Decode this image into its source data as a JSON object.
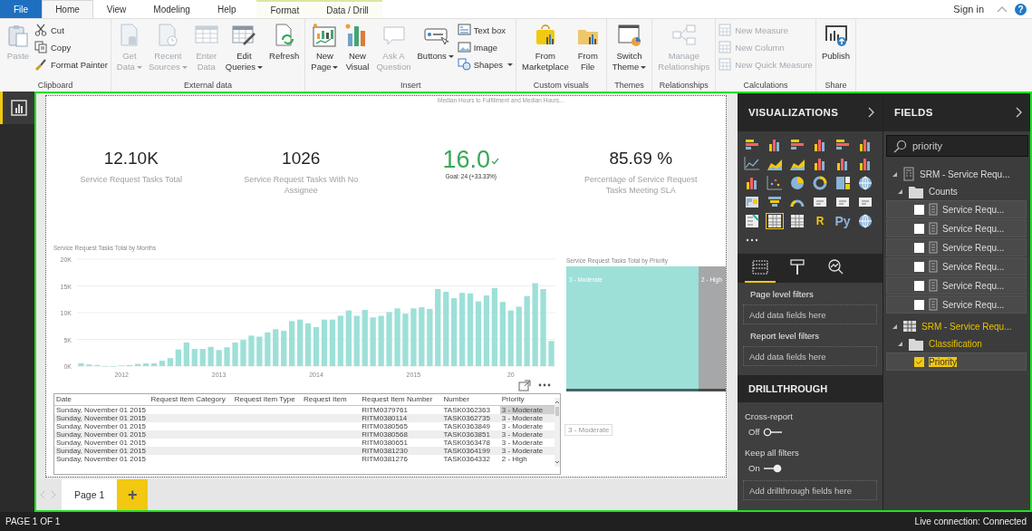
{
  "ribbon": {
    "tabs": [
      {
        "label": "File",
        "kind": "file",
        "selected": false
      },
      {
        "label": "Home",
        "kind": "plain",
        "selected": true
      },
      {
        "label": "View",
        "kind": "plain",
        "selected": false
      },
      {
        "label": "Modeling",
        "kind": "plain",
        "selected": false
      },
      {
        "label": "Help",
        "kind": "plain",
        "selected": false
      },
      {
        "label": "Format",
        "kind": "contextual",
        "selected": false
      },
      {
        "label": "Data / Drill",
        "kind": "contextual",
        "selected": false
      }
    ],
    "sign_in": "Sign in",
    "help": "?",
    "groups": [
      {
        "label": "Clipboard",
        "items": [
          {
            "kind": "large",
            "label": "Paste",
            "disabled": true,
            "dropdown": false
          },
          {
            "kind": "small",
            "label": "Cut",
            "disabled": false,
            "dropdown": false
          },
          {
            "kind": "small",
            "label": "Copy",
            "disabled": false,
            "dropdown": false
          },
          {
            "kind": "small",
            "label": "Format Painter",
            "disabled": false,
            "dropdown": false
          }
        ]
      },
      {
        "label": "External data",
        "items": [
          {
            "kind": "large",
            "label": "Get\nData",
            "disabled": true,
            "dropdown": true
          },
          {
            "kind": "large",
            "label": "Recent\nSources",
            "disabled": true,
            "dropdown": true
          },
          {
            "kind": "large",
            "label": "Enter\nData",
            "disabled": true,
            "dropdown": false
          },
          {
            "kind": "large",
            "label": "Edit\nQueries",
            "disabled": false,
            "dropdown": true
          },
          {
            "kind": "large",
            "label": "Refresh",
            "disabled": false,
            "dropdown": false
          }
        ]
      },
      {
        "label": "Insert",
        "items": [
          {
            "kind": "large",
            "label": "New\nPage",
            "disabled": false,
            "dropdown": true
          },
          {
            "kind": "large",
            "label": "New\nVisual",
            "disabled": false,
            "dropdown": false
          },
          {
            "kind": "large",
            "label": "Ask A\nQuestion",
            "disabled": true,
            "dropdown": false
          },
          {
            "kind": "large",
            "label": "Buttons",
            "disabled": false,
            "dropdown": true
          },
          {
            "kind": "small",
            "label": "Text box",
            "disabled": false,
            "dropdown": false
          },
          {
            "kind": "small",
            "label": "Image",
            "disabled": false,
            "dropdown": false
          },
          {
            "kind": "small",
            "label": "Shapes",
            "disabled": false,
            "dropdown": true
          }
        ]
      },
      {
        "label": "Custom visuals",
        "items": [
          {
            "kind": "large",
            "label": "From\nMarketplace",
            "disabled": false,
            "dropdown": false
          },
          {
            "kind": "large",
            "label": "From\nFile",
            "disabled": false,
            "dropdown": false
          }
        ]
      },
      {
        "label": "Themes",
        "items": [
          {
            "kind": "large",
            "label": "Switch\nTheme",
            "disabled": false,
            "dropdown": true
          }
        ]
      },
      {
        "label": "Relationships",
        "items": [
          {
            "kind": "large",
            "label": "Manage\nRelationships",
            "disabled": true,
            "dropdown": false
          }
        ]
      },
      {
        "label": "Calculations",
        "items": [
          {
            "kind": "small",
            "label": "New Measure",
            "disabled": true,
            "dropdown": false
          },
          {
            "kind": "small",
            "label": "New Column",
            "disabled": true,
            "dropdown": false
          },
          {
            "kind": "small",
            "label": "New Quick Measure",
            "disabled": true,
            "dropdown": false
          }
        ]
      },
      {
        "label": "Share",
        "items": [
          {
            "kind": "large",
            "label": "Publish",
            "disabled": false,
            "dropdown": false
          }
        ]
      }
    ]
  },
  "report": {
    "header_title": "Median Hours to Fulfillment and Median Hours...",
    "cards": [
      {
        "kind": "card",
        "value": "12.10K",
        "label": "Service Request Tasks Total"
      },
      {
        "kind": "card",
        "value": "1026",
        "label": "Service Request Tasks With No Assignee"
      },
      {
        "kind": "kpi",
        "value": "16.0",
        "goal": "Goal: 24 (+33.33%)"
      },
      {
        "kind": "card",
        "value": "85.69 %",
        "label": "Percentage of Service Request Tasks Meeting SLA"
      }
    ],
    "bar_chart": {
      "chart_data": {
        "type": "bar",
        "title": "Service Request Tasks Total by Months",
        "grid": true,
        "color": "#9de0d8",
        "categories": [
          null,
          null,
          null,
          null,
          null,
          "2012",
          null,
          null,
          null,
          null,
          null,
          null,
          null,
          null,
          null,
          null,
          null,
          "2013",
          null,
          null,
          null,
          null,
          null,
          null,
          null,
          null,
          null,
          null,
          null,
          "2014",
          null,
          null,
          null,
          null,
          null,
          null,
          null,
          null,
          null,
          null,
          null,
          "2015",
          null,
          null,
          null,
          null,
          null,
          null,
          null,
          null,
          null,
          null,
          null,
          "20",
          null,
          null,
          null,
          null,
          null
        ],
        "values": [
          0.5,
          0.3,
          0.2,
          0,
          0,
          0.1,
          0.2,
          0.4,
          0.5,
          0.5,
          1,
          1.5,
          3.1,
          4.4,
          3.2,
          3.2,
          3.6,
          3,
          3.5,
          4.4,
          4.9,
          5.7,
          5.5,
          6.3,
          6.9,
          6.6,
          8.4,
          8.7,
          8,
          7.3,
          8.7,
          8.7,
          9.4,
          10.4,
          9.4,
          10.5,
          9.1,
          9.4,
          10.1,
          10.8,
          9.8,
          10.8,
          11,
          10.7,
          14.4,
          13.9,
          12.7,
          13.7,
          13.6,
          12.1,
          13.2,
          14.6,
          12,
          10.4,
          11.1,
          13.1,
          15.5,
          14.4,
          4.7
        ],
        "ylim": [
          0,
          20
        ],
        "yticks": [
          {
            "value": 0,
            "label": "0K"
          },
          {
            "value": 5,
            "label": "5K"
          },
          {
            "value": 10,
            "label": "10K"
          },
          {
            "value": 15,
            "label": "15K"
          },
          {
            "value": 20,
            "label": "20K"
          }
        ]
      }
    },
    "treemap": {
      "title": "Service Request Tasks Total by Priority",
      "tiles": [
        {
          "label": "3 - Moderate",
          "color": "#9de0d8"
        },
        {
          "label": "2 - High",
          "color": "#a5a7a9"
        }
      ]
    },
    "table": {
      "columns": [
        "Date",
        "Request Item Category",
        "Request Item Type",
        "Request Item",
        "Request Item Number",
        "Number",
        "Priority"
      ],
      "rows": [
        {
          "hovered": true,
          "cells": [
            "Sunday, November 01 2015",
            null,
            null,
            null,
            "RITM0379761",
            "TASK0362363",
            "3 - Moderate"
          ]
        },
        {
          "hovered": false,
          "cells": [
            "Sunday, November 01 2015",
            null,
            null,
            null,
            "RITM0380114",
            "TASK0362735",
            "3 - Moderate"
          ]
        },
        {
          "hovered": false,
          "cells": [
            "Sunday, November 01 2015",
            null,
            null,
            null,
            "RITM0380565",
            "TASK0363849",
            "3 - Moderate"
          ]
        },
        {
          "hovered": false,
          "cells": [
            "Sunday, November 01 2015",
            null,
            null,
            null,
            "RITM0380568",
            "TASK0363851",
            "3 - Moderate"
          ]
        },
        {
          "hovered": false,
          "cells": [
            "Sunday, November 01 2015",
            null,
            null,
            null,
            "RITM0380651",
            "TASK0363478",
            "3 - Moderate"
          ]
        },
        {
          "hovered": false,
          "cells": [
            "Sunday, November 01 2015",
            null,
            null,
            null,
            "RITM0381230",
            "TASK0364199",
            "3 - Moderate"
          ]
        },
        {
          "hovered": false,
          "cells": [
            "Sunday, November 01 2015",
            null,
            null,
            null,
            "RITM0381276",
            "TASK0364332",
            "2 - High"
          ]
        }
      ],
      "tooltip": "3 - Moderate"
    },
    "pages": [
      {
        "label": "Page 1",
        "selected": true
      }
    ],
    "add_page": "+"
  },
  "visualizations": {
    "title": "VISUALIZATIONS",
    "gallery": [
      {
        "selected": false
      },
      {
        "selected": false
      },
      {
        "selected": false
      },
      {
        "selected": false
      },
      {
        "selected": false
      },
      {
        "selected": false
      },
      {
        "selected": false
      },
      {
        "selected": false
      },
      {
        "selected": false
      },
      {
        "selected": false
      },
      {
        "selected": false
      },
      {
        "selected": false
      },
      {
        "selected": false
      },
      {
        "selected": false
      },
      {
        "selected": false
      },
      {
        "selected": false
      },
      {
        "selected": false
      },
      {
        "selected": false
      },
      {
        "selected": false
      },
      {
        "selected": false
      },
      {
        "selected": false
      },
      {
        "selected": false
      },
      {
        "selected": false
      },
      {
        "selected": false
      },
      {
        "selected": false
      },
      {
        "selected": true
      },
      {
        "selected": false
      },
      {
        "selected": false,
        "label": "R"
      },
      {
        "selected": false,
        "label": "Py"
      },
      {
        "selected": false
      }
    ],
    "pane_tabs": [
      {
        "selected": true
      },
      {
        "selected": false
      },
      {
        "selected": false
      }
    ],
    "page_filters": {
      "label": "Page level filters",
      "placeholder": "Add data fields here"
    },
    "report_filters": {
      "label": "Report level filters",
      "placeholder": "Add data fields here"
    },
    "drillthrough": {
      "title": "DRILLTHROUGH",
      "toggles": [
        {
          "label": "Cross-report",
          "state_label": "Off",
          "on": false
        },
        {
          "label": "Keep all filters",
          "state_label": "On",
          "on": true
        }
      ],
      "placeholder": "Add drillthrough fields here"
    }
  },
  "fields": {
    "title": "FIELDS",
    "search": {
      "value": "priority"
    },
    "tree": [
      {
        "kind": "table",
        "label": "SRM - Service Requ...",
        "active": false,
        "expanded": true,
        "children": [
          {
            "kind": "folder",
            "label": "Counts",
            "active": false,
            "expanded": true,
            "children": [
              {
                "kind": "measure",
                "label": "Service Requ...",
                "checked": false,
                "matched": false
              },
              {
                "kind": "measure",
                "label": "Service Requ...",
                "checked": false,
                "matched": false
              },
              {
                "kind": "measure",
                "label": "Service Requ...",
                "checked": false,
                "matched": false
              },
              {
                "kind": "measure",
                "label": "Service Requ...",
                "checked": false,
                "matched": false
              },
              {
                "kind": "measure",
                "label": "Service Requ...",
                "checked": false,
                "matched": false
              },
              {
                "kind": "measure",
                "label": "Service Requ...",
                "checked": false,
                "matched": false
              }
            ]
          }
        ]
      },
      {
        "kind": "grid",
        "label": "SRM - Service Requ...",
        "active": true,
        "expanded": true,
        "children": [
          {
            "kind": "folder",
            "label": "Classification",
            "active": true,
            "expanded": true,
            "children": [
              {
                "kind": "field",
                "label": "Priority",
                "checked": true,
                "matched": true
              }
            ]
          }
        ]
      }
    ]
  },
  "status_bar": {
    "page": "PAGE 1 OF 1",
    "connection": "Live connection: Connected"
  }
}
